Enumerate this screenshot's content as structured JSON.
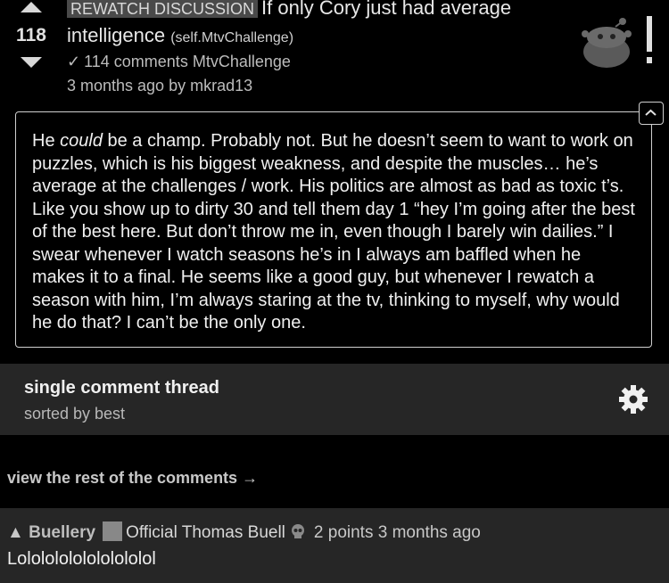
{
  "post": {
    "score": "118",
    "flair": "REWATCH DISCUSSION",
    "title": "If only Cory just had average intelligence",
    "domain": "(self.MtvChallenge)",
    "comments": "114 comments",
    "subreddit": "MtvChallenge",
    "submitted": "3 months ago by mkrad13",
    "selftext_parts": [
      "He ",
      "could",
      " be a champ. Probably not. But he doesn’t seem to want to work on puzzles, which is his biggest weakness, and despite the muscles… he’s average at the challenges / work. His politics are almost as bad as toxic t’s. Like you show up to dirty 30 and tell them day 1 “hey I’m going after the best of the best here. But don’t throw me in, even though I barely win dailies.” I swear whenever I watch seasons he’s in I always am baffled when he makes it to a final. He seems like a good guy, but whenever I rewatch a season with him, I’m always staring at the tv, thinking to myself, why would he do that? I can’t be the only one."
    ]
  },
  "thread": {
    "title": "single comment thread",
    "sort": "sorted by best"
  },
  "view_rest": "view the rest of the comments →",
  "comment": {
    "arrow": "▲",
    "author": "Buellery",
    "flair": "Official Thomas Buell",
    "points": "2 points",
    "time": "3 months ago",
    "body": "Lolololololololololol"
  },
  "icons": [
    "arrow-up-icon",
    "arrow-down-icon",
    "checkmark-icon",
    "reddit-mascot-icon",
    "chevron-up-icon",
    "gear-icon",
    "skull-icon"
  ]
}
